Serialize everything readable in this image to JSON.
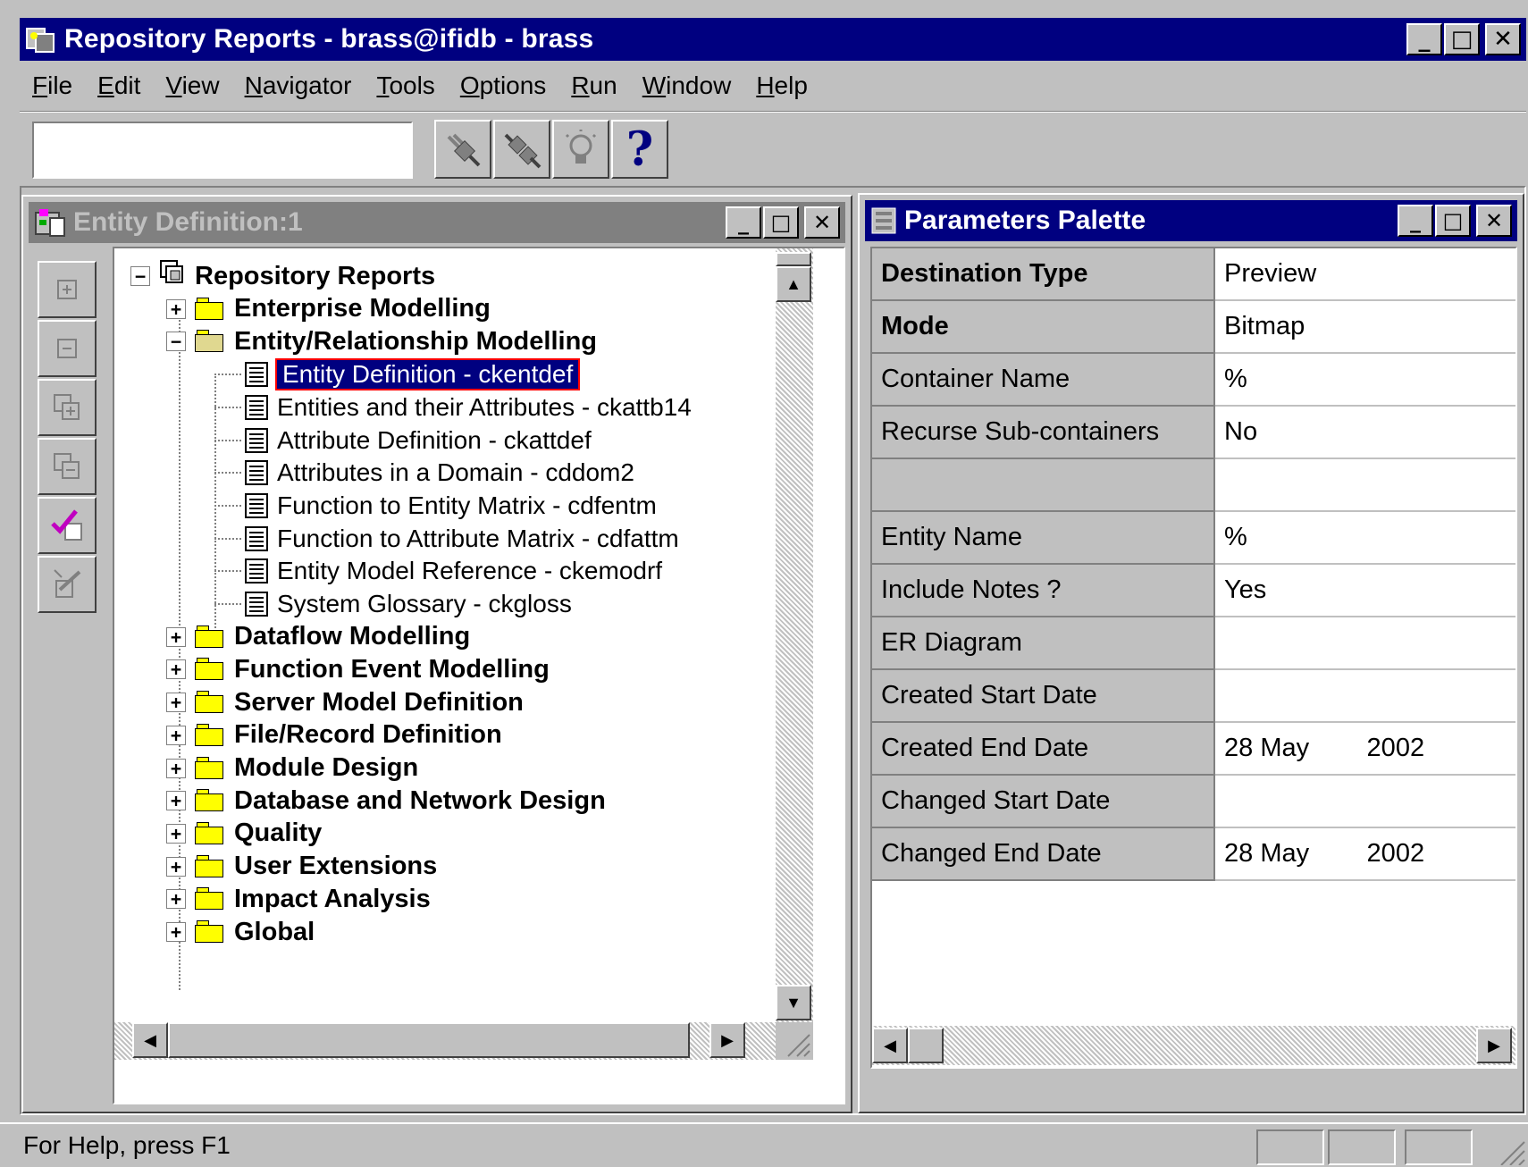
{
  "app": {
    "title": "Repository Reports - brass@ifidb - brass",
    "controls": {
      "minimize": "_",
      "maximize": "□",
      "close": "✕"
    }
  },
  "menu": [
    {
      "label": "File",
      "u": "F",
      "rest": "ile"
    },
    {
      "label": "Edit",
      "u": "E",
      "rest": "dit"
    },
    {
      "label": "View",
      "u": "V",
      "rest": "iew"
    },
    {
      "label": "Navigator",
      "u": "N",
      "rest": "avigator"
    },
    {
      "label": "Tools",
      "u": "T",
      "rest": "ools"
    },
    {
      "label": "Options",
      "u": "O",
      "rest": "ptions"
    },
    {
      "label": "Run",
      "u": "R",
      "rest": "un"
    },
    {
      "label": "Window",
      "u": "W",
      "rest": "indow"
    },
    {
      "label": "Help",
      "u": "H",
      "rest": "elp"
    }
  ],
  "toolbar": {
    "input_value": "",
    "buttons": [
      "connect-icon",
      "disconnect-icon",
      "lightbulb-icon",
      "help-icon"
    ],
    "help_glyph": "?"
  },
  "entity_window": {
    "title": "Entity Definition:1",
    "vertical_tools": [
      "expand-icon",
      "collapse-icon",
      "expand-all-icon",
      "collapse-all-icon",
      "check-icon",
      "edit-icon"
    ]
  },
  "tree": {
    "root": "Repository Reports",
    "enterprise": "Enterprise Modelling",
    "er_modelling": "Entity/Relationship Modelling",
    "reports": [
      "Entity Definition - ckentdef",
      "Entities and their Attributes - ckattb14",
      "Attribute Definition - ckattdef",
      "Attributes in a Domain - cddom2",
      "Function to Entity Matrix - cdfentm",
      "Function to Attribute Matrix - cdfattm",
      "Entity Model Reference - ckemodrf",
      "System Glossary - ckgloss"
    ],
    "folders": [
      "Dataflow Modelling",
      "Function Event Modelling",
      "Server Model Definition",
      "File/Record Definition",
      "Module Design",
      "Database and Network Design",
      "Quality",
      "User Extensions",
      "Impact Analysis",
      "Global"
    ]
  },
  "params_window": {
    "title": "Parameters Palette",
    "rows": [
      {
        "name": "Destination Type",
        "value": "Preview",
        "bold": true
      },
      {
        "name": "Mode",
        "value": "Bitmap",
        "bold": true
      },
      {
        "name": "Container Name",
        "value": "%",
        "bold": false
      },
      {
        "name": "Recurse Sub-containers",
        "value": "No",
        "bold": false
      },
      {
        "name": "",
        "value": "",
        "bold": false
      },
      {
        "name": "Entity Name",
        "value": "%",
        "bold": false
      },
      {
        "name": "Include Notes ?",
        "value": "Yes",
        "bold": false
      },
      {
        "name": "ER Diagram",
        "value": "",
        "bold": false
      },
      {
        "name": "Created Start Date",
        "value": "",
        "bold": false
      },
      {
        "name": "Created End Date",
        "value": "28 May        2002",
        "bold": false
      },
      {
        "name": "Changed Start Date",
        "value": "",
        "bold": false
      },
      {
        "name": "Changed End Date",
        "value": "28 May        2002",
        "bold": false
      }
    ]
  },
  "status": {
    "text": "For Help, press F1"
  },
  "colors": {
    "titlebar_active": "#000080",
    "titlebar_inactive": "#808080",
    "face": "#c0c0c0",
    "folder": "#ffff00"
  }
}
